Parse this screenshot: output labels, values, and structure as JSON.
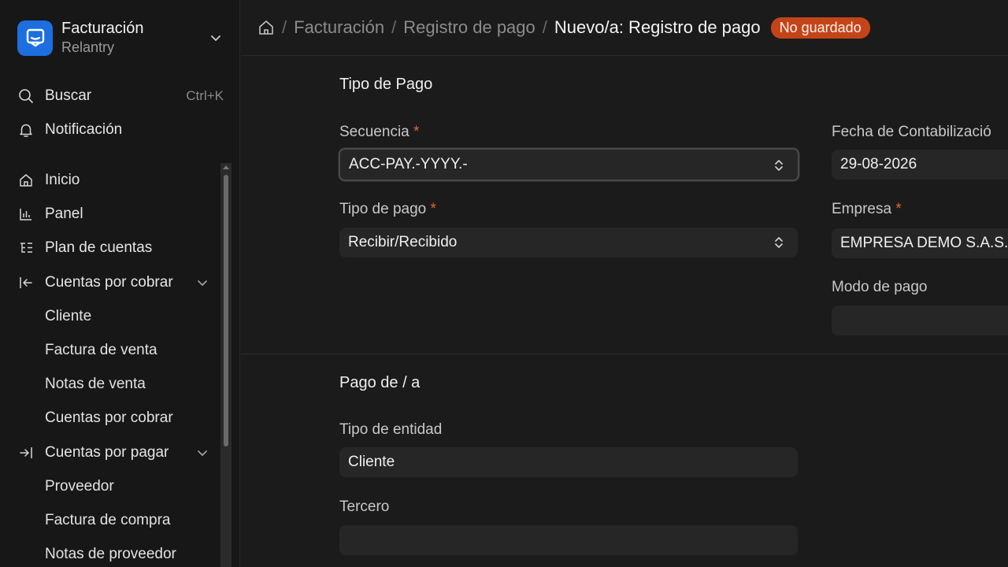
{
  "app": {
    "title": "Facturación",
    "subtitle": "Relantry",
    "logo_color": "#1d6fe0"
  },
  "sidebar": {
    "search_label": "Buscar",
    "search_shortcut": "Ctrl+K",
    "notification_label": "Notificación",
    "items": [
      {
        "label": "Inicio",
        "icon": "home-icon"
      },
      {
        "label": "Panel",
        "icon": "bar-chart-icon"
      },
      {
        "label": "Plan de cuentas",
        "icon": "tree-list-icon"
      },
      {
        "label": "Cuentas por cobrar",
        "icon": "arrow-left-bar-icon"
      },
      {
        "label": "Cliente"
      },
      {
        "label": "Factura de venta"
      },
      {
        "label": "Notas de venta"
      },
      {
        "label": "Cuentas por cobrar"
      },
      {
        "label": "Cuentas por pagar",
        "icon": "arrow-right-bar-icon"
      },
      {
        "label": "Proveedor"
      },
      {
        "label": "Factura de compra"
      },
      {
        "label": "Notas de proveedor"
      }
    ]
  },
  "breadcrumb": {
    "items": [
      "Facturación",
      "Registro de pago"
    ],
    "current": "Nuevo/a: Registro de pago",
    "badge": "No guardado",
    "badge_color": "#c4441a"
  },
  "form": {
    "section1_title": "Tipo de Pago",
    "naming_series_label": "Secuencia",
    "naming_series_value": "ACC-PAY.-YYYY.-",
    "payment_type_label": "Tipo de pago",
    "payment_type_value": "Recibir/Recibido",
    "posting_date_label": "Fecha de Contabilizació",
    "posting_date_value": "29-08-2026",
    "company_label": "Empresa",
    "company_value": "EMPRESA DEMO S.A.S.",
    "mode_of_payment_label": "Modo de pago",
    "mode_of_payment_value": "",
    "section2_title": "Pago de / a",
    "party_type_label": "Tipo de entidad",
    "party_type_value": "Cliente",
    "party_label": "Tercero",
    "party_value": "",
    "required_mark": "*"
  }
}
